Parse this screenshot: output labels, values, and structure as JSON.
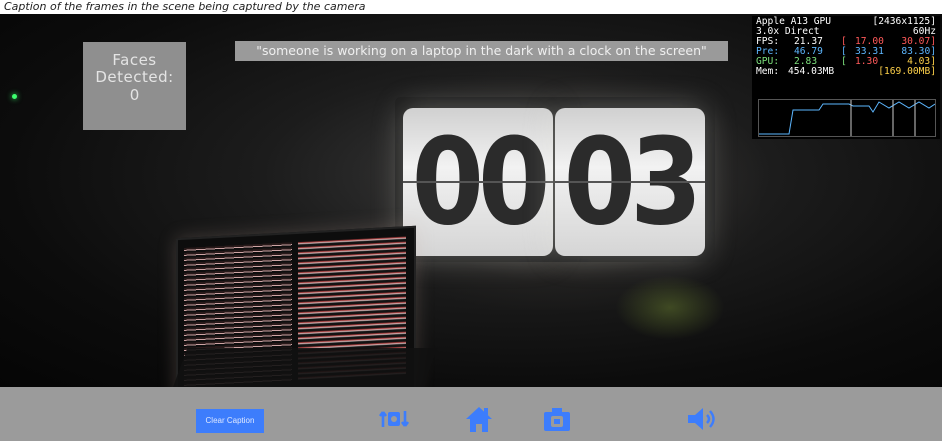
{
  "top_strip_text": "Caption of the frames in the scene being captured by the camera",
  "faces": {
    "label": "Faces Detected:",
    "count": "0"
  },
  "caption": "\"someone is working on a laptop in the dark with a clock on the screen\"",
  "clock": {
    "left_digits": "00",
    "right_digits": "03"
  },
  "gpu_hud": {
    "device": "Apple A13 GPU",
    "resolution": "[2436x1125]",
    "scale_mode": "3.0x Direct",
    "refresh": "60Hz",
    "fps_label": "FPS:",
    "fps_value": "21.37",
    "fps_bracket_open": "[",
    "fps_min": "17.00",
    "fps_max": "30.07]",
    "pre_label": "Pre:",
    "pre_value": "46.79",
    "pre_bracket_open": "[",
    "pre_min": "33.31",
    "pre_max": "83.30]",
    "gpu_label": "GPU:",
    "gpu_value": "2.83",
    "gpu_bracket_open": "[",
    "gpu_min": "1.30",
    "gpu_max": "4.03]",
    "mem_label": "Mem:",
    "mem_value": "454.03MB",
    "mem_peak": "[169.00MB]"
  },
  "bottom_bar": {
    "clear_caption_label": "Clear Caption"
  },
  "icons": {
    "switch_camera": "switch-camera-icon",
    "home": "home-icon",
    "camera": "camera-icon",
    "speaker": "speaker-icon"
  },
  "colors": {
    "accent_blue": "#3d7dfc",
    "bar_gray": "#9b9b9b",
    "hud_blue": "#5db7ff",
    "hud_red": "#ff5a5a",
    "hud_green": "#7de07d"
  }
}
